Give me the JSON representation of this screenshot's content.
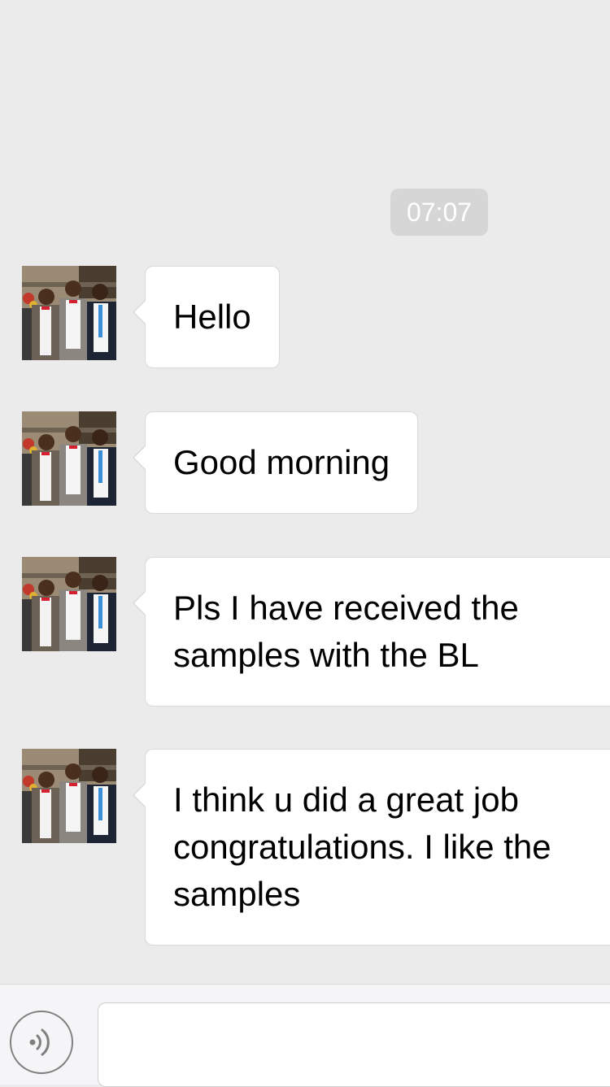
{
  "conversation": {
    "timestamp": "07:07",
    "messages": [
      {
        "sender": "contact",
        "lines": [
          "Hello"
        ]
      },
      {
        "sender": "contact",
        "lines": [
          "Good morning"
        ]
      },
      {
        "sender": "contact",
        "lines": [
          "Pls I have received the",
          "samples with the BL"
        ]
      },
      {
        "sender": "contact",
        "lines": [
          "I think u did a great job",
          "congratulations. I like the",
          "samples"
        ]
      }
    ]
  },
  "composer": {
    "voice_icon": "voice-icon",
    "input_value": ""
  },
  "colors": {
    "background": "#ebebeb",
    "bubble": "#ffffff",
    "timestamp_badge": "#d6d6d6",
    "bottom_bar": "#f5f5f7"
  }
}
